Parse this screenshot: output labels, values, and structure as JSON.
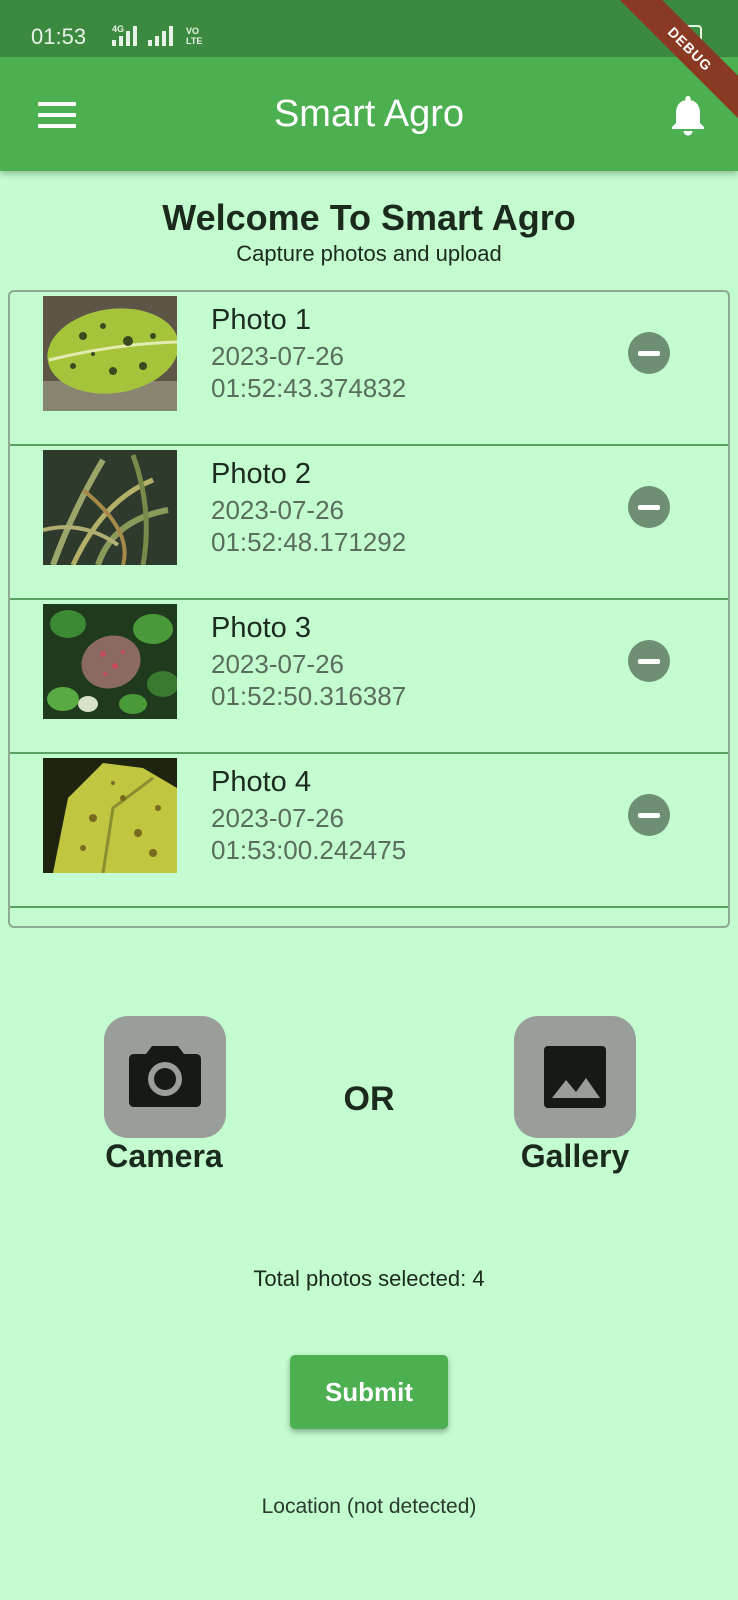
{
  "status_bar": {
    "time": "01:53",
    "network_1": "4G",
    "network_2_line1": "VO",
    "network_2_line2": "LTE",
    "battery": "55"
  },
  "debug_banner": "DEBUG",
  "app_bar": {
    "title": "Smart Agro",
    "left_icon": "menu-icon",
    "right_icon": "bell-icon",
    "color": "#4caf50"
  },
  "header": {
    "title": "Welcome To Smart Agro",
    "subtitle": "Capture photos and upload"
  },
  "photos": [
    {
      "name": "Photo 1",
      "date": "2023-07-26",
      "time": "01:52:43.374832"
    },
    {
      "name": "Photo 2",
      "date": "2023-07-26",
      "time": "01:52:48.171292"
    },
    {
      "name": "Photo 3",
      "date": "2023-07-26",
      "time": "01:52:50.316387"
    },
    {
      "name": "Photo 4",
      "date": "2023-07-26",
      "time": "01:53:00.242475"
    }
  ],
  "source_options": {
    "camera_label": "Camera",
    "or_label": "OR",
    "gallery_label": "Gallery"
  },
  "total_text": "Total photos selected: 4",
  "submit_label": "Submit",
  "location_text": "Location (not detected)",
  "colors": {
    "background": "#c2fccf",
    "status_bar": "#3c8a3f",
    "accent": "#4caf50",
    "remove_button": "#6e8f73"
  }
}
